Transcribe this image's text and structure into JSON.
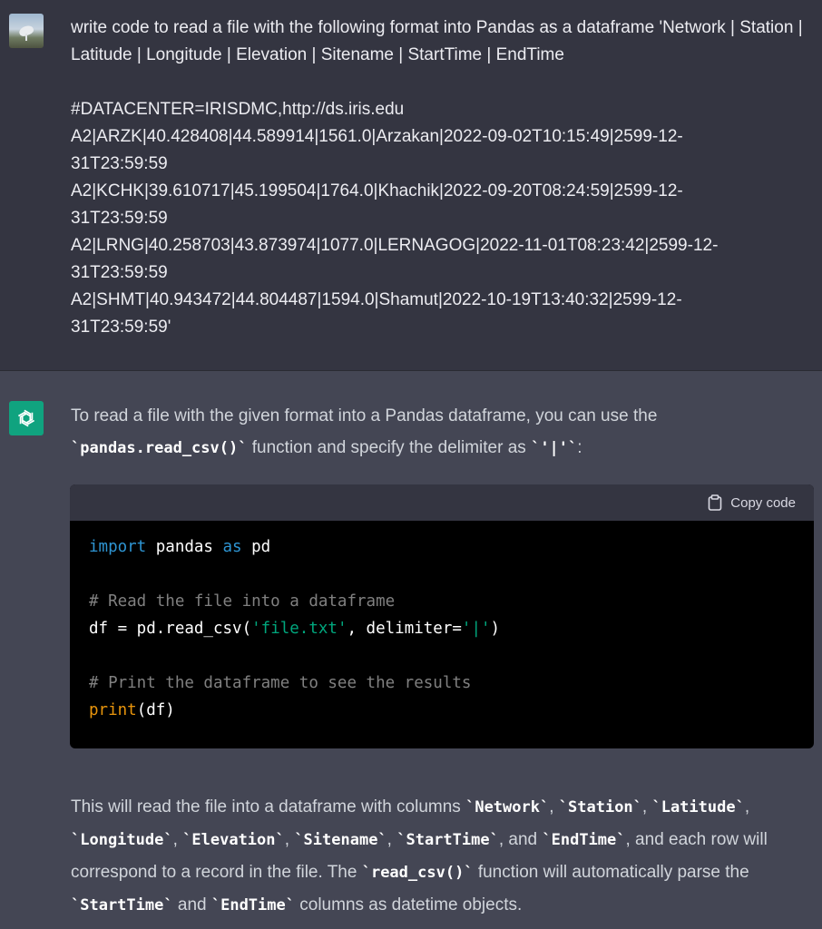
{
  "user": {
    "message": "write code to read a file with the following format into Pandas as a dataframe 'Network | Station | Latitude | Longitude | Elevation | Sitename | StartTime | EndTime\n\n#DATACENTER=IRISDMC,http://ds.iris.edu\nA2|ARZK|40.428408|44.589914|1561.0|Arzakan|2022-09-02T10:15:49|2599-12-\n31T23:59:59\nA2|KCHK|39.610717|45.199504|1764.0|Khachik|2022-09-20T08:24:59|2599-12-\n31T23:59:59\nA2|LRNG|40.258703|43.873974|1077.0|LERNAGOG|2022-11-01T08:23:42|2599-12-\n31T23:59:59\nA2|SHMT|40.943472|44.804487|1594.0|Shamut|2022-10-19T13:40:32|2599-12-\n31T23:59:59'"
  },
  "assistant": {
    "intro": {
      "t1": "To read a file with the given format into a Pandas dataframe, you can use the ",
      "c1": "`pandas.read_csv()`",
      "t2": " function and specify the delimiter as ",
      "c2": "`'|'`",
      "t3": ":"
    },
    "code_block": {
      "copy_label": "Copy code",
      "line1": {
        "kw_import": "import",
        "module": " pandas ",
        "kw_as": "as",
        "alias": " pd"
      },
      "comment1": "# Read the file into a dataframe",
      "line3": {
        "pre": "df = pd.read_csv(",
        "arg": "'file.txt'",
        "mid": ", delimiter=",
        "delim": "'|'",
        "post": ")"
      },
      "comment2": "# Print the dataframe to see the results",
      "line5": {
        "fn": "print",
        "args": "(df)"
      }
    },
    "outro": {
      "t1": "This will read the file into a dataframe with columns ",
      "c_network": "`Network`",
      "t2": ", ",
      "c_station": "`Station`",
      "t3": ", ",
      "c_latitude": "`Latitude`",
      "t4": ", ",
      "c_longitude": "`Longitude`",
      "t5": ", ",
      "c_elevation": "`Elevation`",
      "t6": ", ",
      "c_sitename": "`Sitename`",
      "t7": ", ",
      "c_starttime": "`StartTime`",
      "t8": ", and ",
      "c_endtime": "`EndTime`",
      "t9": ", and each row will correspond to a record in the file. The ",
      "c_readcsv": "`read_csv()`",
      "t10": " function will automatically parse the ",
      "c_starttime2": "`StartTime`",
      "t11": " and ",
      "c_endtime2": "`EndTime`",
      "t12": " columns as datetime objects."
    }
  },
  "colors": {
    "user_bg": "#343541",
    "assistant_bg": "#444654",
    "openai_green": "#10a37f",
    "keyword": "#2e95d3",
    "string": "#00a67d",
    "comment": "#808080",
    "builtin": "#e9950c"
  },
  "icons": {
    "user_avatar": "satellite-dish-photo",
    "assistant_avatar": "openai-logo-icon",
    "copy": "clipboard-icon"
  }
}
